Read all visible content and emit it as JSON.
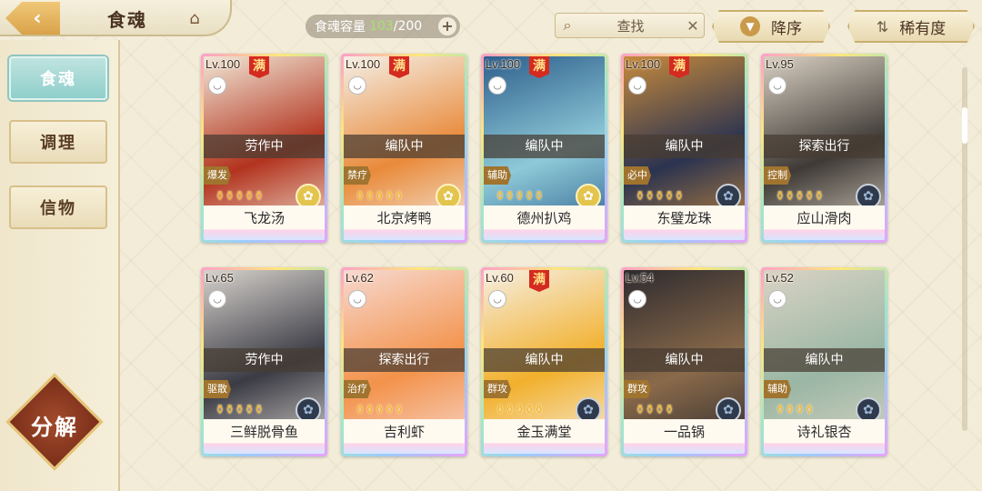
{
  "header": {
    "title": "食魂",
    "capacity_label": "食魂容量",
    "capacity_current": "103",
    "capacity_max": "/200",
    "search_placeholder": "查找",
    "sort_desc_label": "降序",
    "sort_rarity_label": "稀有度"
  },
  "sidebar": {
    "items": [
      {
        "label": "食魂",
        "active": true
      },
      {
        "label": "调理",
        "active": false
      },
      {
        "label": "信物",
        "active": false
      }
    ],
    "decompose_label": "分解"
  },
  "cards": [
    {
      "level": "Lv.100",
      "max": "满",
      "status": "劳作中",
      "role": "爆发",
      "name": "飞龙汤",
      "stars": "⚱⚱⚱⚱⚱",
      "element": "gold",
      "art": [
        "#b2331e",
        "#f1e7d6"
      ]
    },
    {
      "level": "Lv.100",
      "max": "满",
      "status": "编队中",
      "role": "禁疗",
      "name": "北京烤鸭",
      "stars": "⚱⚱⚱⚱⚱",
      "element": "gold",
      "art": [
        "#e98a3a",
        "#f4efe6"
      ]
    },
    {
      "level": "Lv.100",
      "max": "满",
      "status": "编队中",
      "role": "辅助",
      "name": "德州扒鸡",
      "stars": "⚱⚱⚱⚱⚱",
      "element": "gold",
      "art": [
        "#8ec9d8",
        "#2e5f8c"
      ]
    },
    {
      "level": "Lv.100",
      "max": "满",
      "status": "编队中",
      "role": "必中",
      "name": "东璧龙珠",
      "stars": "⚱⚱⚱⚱⚱",
      "element": "dark",
      "art": [
        "#2b3350",
        "#c68a3c"
      ]
    },
    {
      "level": "Lv.95",
      "max": "",
      "status": "探索出行",
      "role": "控制",
      "name": "应山滑肉",
      "stars": "⚱⚱⚱⚱⚱",
      "element": "dark",
      "art": [
        "#3f3a36",
        "#d9d0c2"
      ]
    },
    {
      "level": "Lv.65",
      "max": "",
      "status": "劳作中",
      "role": "驱散",
      "name": "三鲜脱骨鱼",
      "stars": "⚱⚱⚱⚱⚱",
      "element": "dark",
      "art": [
        "#3b3b44",
        "#d6d2cc"
      ]
    },
    {
      "level": "Lv.62",
      "max": "",
      "status": "探索出行",
      "role": "治疗",
      "name": "吉利虾",
      "stars": "⚱⚱⚱⚱⚱",
      "element": "none",
      "art": [
        "#f3924a",
        "#f7d9d0"
      ]
    },
    {
      "level": "Lv.60",
      "max": "满",
      "status": "编队中",
      "role": "群攻",
      "name": "金玉满堂",
      "stars": "⚱⚱⚱⚱⚱",
      "element": "dark",
      "art": [
        "#f2b02c",
        "#f6eee0"
      ]
    },
    {
      "level": "Lv.54",
      "max": "",
      "status": "编队中",
      "role": "群攻",
      "name": "一品锅",
      "stars": "⚱⚱⚱⚱",
      "element": "dark",
      "art": [
        "#8a6a4a",
        "#2e2b2f"
      ]
    },
    {
      "level": "Lv.52",
      "max": "",
      "status": "编队中",
      "role": "辅助",
      "name": "诗礼银杏",
      "stars": "⚱⚱⚱⚱",
      "element": "dark",
      "art": [
        "#9ab6a4",
        "#d9d3c4"
      ]
    }
  ]
}
